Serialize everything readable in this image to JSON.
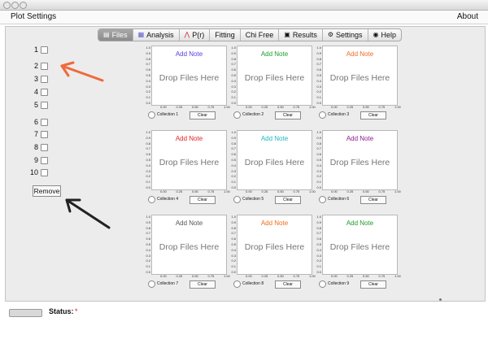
{
  "menu": {
    "left": "Plot Settings",
    "right": "About"
  },
  "tabs": [
    {
      "label": "Files",
      "icon": "folder-icon",
      "active": true
    },
    {
      "label": "Analysis",
      "icon": "chart-icon"
    },
    {
      "label": "P(r)",
      "icon": "distribution-icon"
    },
    {
      "label": "Fitting",
      "icon": ""
    },
    {
      "label": "Chi Free",
      "icon": ""
    },
    {
      "label": "Results",
      "icon": "document-icon"
    },
    {
      "label": "Settings",
      "icon": "gear-icon"
    },
    {
      "label": "Help",
      "icon": "help-icon"
    }
  ],
  "file_slots": [
    "1",
    "2",
    "3",
    "4",
    "5",
    "6",
    "7",
    "8",
    "9",
    "10"
  ],
  "remove_label": "Remove",
  "plot_axes": {
    "y_ticks": [
      "1.0",
      "0.9",
      "0.8",
      "0.7",
      "0.6",
      "0.5",
      "0.4",
      "0.3",
      "0.2",
      "0.1",
      "0.0"
    ],
    "x_ticks": [
      "0.00",
      "0.25",
      "0.50",
      "0.75",
      "1.00"
    ]
  },
  "collections": [
    {
      "name": "Collection 1",
      "note": "Add Note",
      "note_color": "#5a3ee0",
      "drop": "Drop Files Here",
      "clear": "Clear"
    },
    {
      "name": "Collection 2",
      "note": "Add Note",
      "note_color": "#1f9a2e",
      "drop": "Drop Files Here",
      "clear": "Clear"
    },
    {
      "name": "Collection 3",
      "note": "Add Note",
      "note_color": "#ef6d1c",
      "drop": "Drop Files Here",
      "clear": "Clear"
    },
    {
      "name": "Collection 4",
      "note": "Add Note",
      "note_color": "#e52228",
      "drop": "Drop Files Here",
      "clear": "Clear"
    },
    {
      "name": "Collection 5",
      "note": "Add Note",
      "note_color": "#22b6c2",
      "drop": "Drop Files Here",
      "clear": "Clear"
    },
    {
      "name": "Collection 6",
      "note": "Add Note",
      "note_color": "#8c1a8f",
      "drop": "Drop Files Here",
      "clear": "Clear"
    },
    {
      "name": "Collection 7",
      "note": "Add Note",
      "note_color": "#555555",
      "drop": "Drop Files Here",
      "clear": "Clear"
    },
    {
      "name": "Collection 8",
      "note": "Add Note",
      "note_color": "#ef6d1c",
      "drop": "Drop Files Here",
      "clear": "Clear"
    },
    {
      "name": "Collection 9",
      "note": "Add Note",
      "note_color": "#1f9a2e",
      "drop": "Drop Files Here",
      "clear": "Clear"
    }
  ],
  "status": {
    "label": "Status:",
    "value": "*",
    "value_color": "#e02020"
  },
  "annotation_colors": {
    "red_arrow": "#f06a3c",
    "black_arrow": "#222222"
  }
}
